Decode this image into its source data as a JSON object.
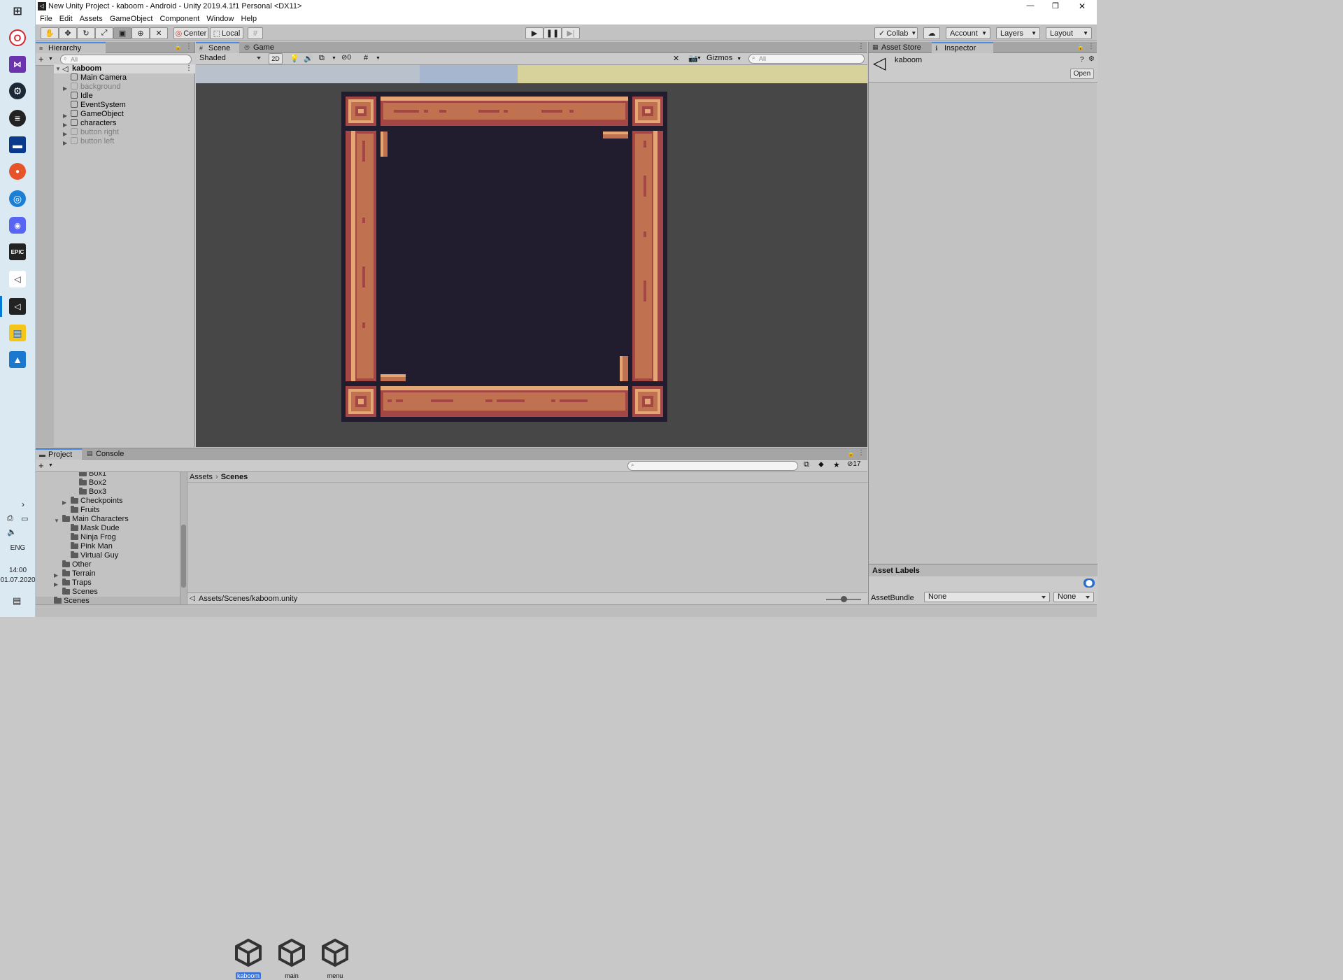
{
  "window": {
    "title": "New Unity Project - kaboom - Android - Unity 2019.4.1f1 Personal <DX11>",
    "controls": [
      "—",
      "❐",
      "✕"
    ]
  },
  "menu": [
    "File",
    "Edit",
    "Assets",
    "GameObject",
    "Component",
    "Window",
    "Help"
  ],
  "toolbar": {
    "pivot": "Center",
    "space": "Local",
    "collab": "Collab",
    "account": "Account",
    "layers": "Layers",
    "layout": "Layout"
  },
  "hierarchy": {
    "tab": "Hierarchy",
    "search_placeholder": "All",
    "scene": "kaboom",
    "items": [
      {
        "label": "Main Camera",
        "dim": false,
        "expandable": false
      },
      {
        "label": "background",
        "dim": true,
        "expandable": true
      },
      {
        "label": "Idle",
        "dim": false,
        "expandable": false
      },
      {
        "label": "EventSystem",
        "dim": false,
        "expandable": false
      },
      {
        "label": "GameObject",
        "dim": false,
        "expandable": true
      },
      {
        "label": "characters",
        "dim": false,
        "expandable": true
      },
      {
        "label": "button right",
        "dim": true,
        "expandable": true
      },
      {
        "label": "button left",
        "dim": true,
        "expandable": true
      }
    ]
  },
  "scene_view": {
    "tabs": [
      "Scene",
      "Game"
    ],
    "shading": "Shaded",
    "mode_2d": "2D",
    "hidden_count": "0",
    "gizmos": "Gizmos",
    "search_placeholder": "All"
  },
  "inspector": {
    "tabs": [
      "Asset Store",
      "Inspector"
    ],
    "asset_name": "kaboom",
    "open_button": "Open",
    "labels_header": "Asset Labels",
    "bundle_label": "AssetBundle",
    "bundle_value": "None",
    "variant_value": "None"
  },
  "project": {
    "tabs": [
      "Project",
      "Console"
    ],
    "hidden_count": "17",
    "breadcrumb": [
      "Assets",
      "Scenes"
    ],
    "tree": [
      {
        "label": "Box1",
        "indent": 3,
        "arrow": "",
        "open": false
      },
      {
        "label": "Box2",
        "indent": 3,
        "arrow": "",
        "open": false
      },
      {
        "label": "Box3",
        "indent": 3,
        "arrow": "",
        "open": false
      },
      {
        "label": "Checkpoints",
        "indent": 2,
        "arrow": "▶",
        "open": false
      },
      {
        "label": "Fruits",
        "indent": 2,
        "arrow": "",
        "open": false
      },
      {
        "label": "Main Characters",
        "indent": 1,
        "arrow": "▼",
        "open": true
      },
      {
        "label": "Mask Dude",
        "indent": 2,
        "arrow": "",
        "open": false
      },
      {
        "label": "Ninja Frog",
        "indent": 2,
        "arrow": "",
        "open": false
      },
      {
        "label": "Pink Man",
        "indent": 2,
        "arrow": "",
        "open": false
      },
      {
        "label": "Virtual Guy",
        "indent": 2,
        "arrow": "",
        "open": false
      },
      {
        "label": "Other",
        "indent": 1,
        "arrow": "",
        "open": false
      },
      {
        "label": "Terrain",
        "indent": 1,
        "arrow": "▶",
        "open": false
      },
      {
        "label": "Traps",
        "indent": 1,
        "arrow": "▶",
        "open": false
      },
      {
        "label": "Scenes",
        "indent": 1,
        "arrow": "",
        "open": false
      },
      {
        "label": "Scenes",
        "indent": 0,
        "arrow": "",
        "open": false
      }
    ],
    "assets": [
      {
        "label": "kaboom",
        "selected": true
      },
      {
        "label": "main",
        "selected": false
      },
      {
        "label": "menu",
        "selected": false
      }
    ],
    "status_path": "Assets/Scenes/kaboom.unity"
  },
  "system": {
    "language": "ENG",
    "time": "14:00",
    "date": "01.07.2020"
  },
  "colors": {
    "accent": "#3a72d8",
    "frame_wood": "#c0714f",
    "frame_dark": "#a54646",
    "frame_light": "#e4a672",
    "scene_bg": "#474747",
    "board_bg": "#211c2e"
  }
}
